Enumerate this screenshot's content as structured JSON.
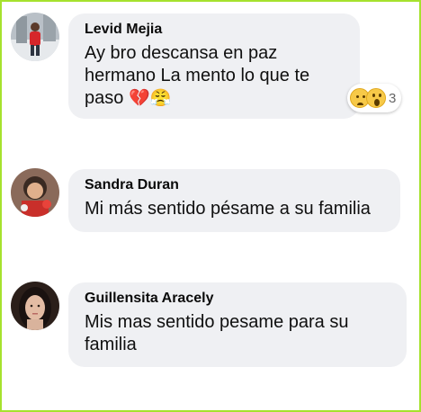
{
  "comments": [
    {
      "author": "Levid Mejia",
      "text": "Ay bro descansa en paz hermano La mento lo que te paso",
      "emojis": [
        "💔",
        "😤"
      ],
      "avatar_icon": "avatar-photo",
      "reactions": {
        "icons": [
          "sad-face-icon",
          "wow-face-icon"
        ],
        "count": "3"
      }
    },
    {
      "author": "Sandra Duran",
      "text": "Mi más sentido pésame a su familia",
      "avatar_icon": "avatar-photo"
    },
    {
      "author": "Guillensita Aracely",
      "text": "Mis mas sentido pesame para su familia",
      "avatar_icon": "avatar-photo"
    }
  ],
  "colors": {
    "bubble_bg": "#eff0f3",
    "frame_border": "#a6e22e",
    "author_text": "#0a0a0a"
  }
}
